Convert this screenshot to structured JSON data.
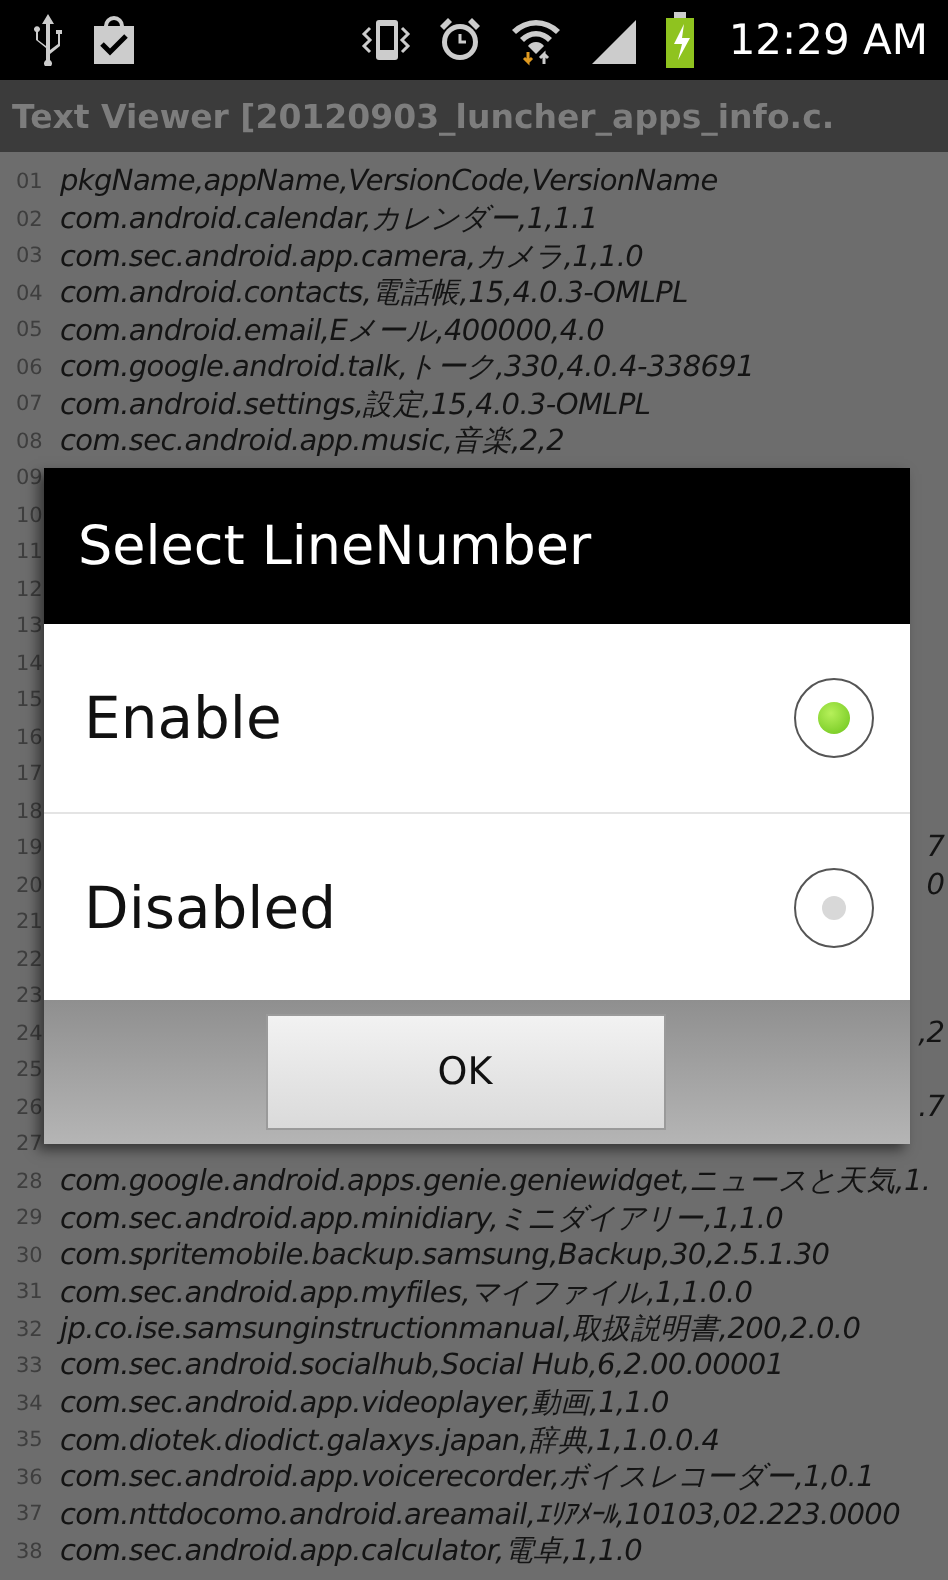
{
  "status_bar": {
    "time": "12:29 AM"
  },
  "window": {
    "title": "Text Viewer [20120903_luncher_apps_info.c."
  },
  "lines": [
    {
      "number": "01",
      "text": "pkgName,appName,VersionCode,VersionName"
    },
    {
      "number": "02",
      "text": "com.android.calendar,カレンダー,1,1.1"
    },
    {
      "number": "03",
      "text": "com.sec.android.app.camera,カメラ,1,1.0"
    },
    {
      "number": "04",
      "text": "com.android.contacts,電話帳,15,4.0.3-OMLPL"
    },
    {
      "number": "05",
      "text": "com.android.email,Eメール,400000,4.0"
    },
    {
      "number": "06",
      "text": "com.google.android.talk,トーク,330,4.0.4-338691"
    },
    {
      "number": "07",
      "text": "com.android.settings,設定,15,4.0.3-OMLPL"
    },
    {
      "number": "08",
      "text": "com.sec.android.app.music,音楽,2,2"
    },
    {
      "number": "09"
    },
    {
      "number": "10"
    },
    {
      "number": "11"
    },
    {
      "number": "12"
    },
    {
      "number": "13"
    },
    {
      "number": "14"
    },
    {
      "number": "15"
    },
    {
      "number": "16"
    },
    {
      "number": "17"
    },
    {
      "number": "18"
    },
    {
      "number": "19",
      "tail": "7"
    },
    {
      "number": "20",
      "tail": "0"
    },
    {
      "number": "21"
    },
    {
      "number": "22"
    },
    {
      "number": "23"
    },
    {
      "number": "24",
      "tail": ",2"
    },
    {
      "number": "25"
    },
    {
      "number": "26",
      "tail": ".7"
    },
    {
      "number": "27"
    },
    {
      "number": "28",
      "text": "com.google.android.apps.genie.geniewidget,ニュースと天気,1."
    },
    {
      "number": "29",
      "text": "com.sec.android.app.minidiary,ミニダイアリー,1,1.0"
    },
    {
      "number": "30",
      "text": "com.spritemobile.backup.samsung,Backup,30,2.5.1.30"
    },
    {
      "number": "31",
      "text": "com.sec.android.app.myfiles,マイファイル,1,1.0.0"
    },
    {
      "number": "32",
      "text": "jp.co.ise.samsunginstructionmanual,取扱説明書,200,2.0.0"
    },
    {
      "number": "33",
      "text": "com.sec.android.socialhub,Social Hub,6,2.00.00001"
    },
    {
      "number": "34",
      "text": "com.sec.android.app.videoplayer,動画,1,1.0"
    },
    {
      "number": "35",
      "text": "com.diotek.diodict.galaxys.japan,辞典,1,1.0.0.4"
    },
    {
      "number": "36",
      "text": "com.sec.android.app.voicerecorder,ボイスレコーダー,1,0.1"
    },
    {
      "number": "37",
      "text": "com.nttdocomo.android.areamail,ｴﾘｱﾒｰﾙ,10103,02.223.0000"
    },
    {
      "number": "38",
      "text": "com.sec.android.app.calculator,電卓,1,1.0"
    }
  ],
  "dialog": {
    "title": "Select LineNumber",
    "options": [
      {
        "label": "Enable",
        "selected": true
      },
      {
        "label": "Disabled",
        "selected": false
      }
    ],
    "button": "OK"
  }
}
